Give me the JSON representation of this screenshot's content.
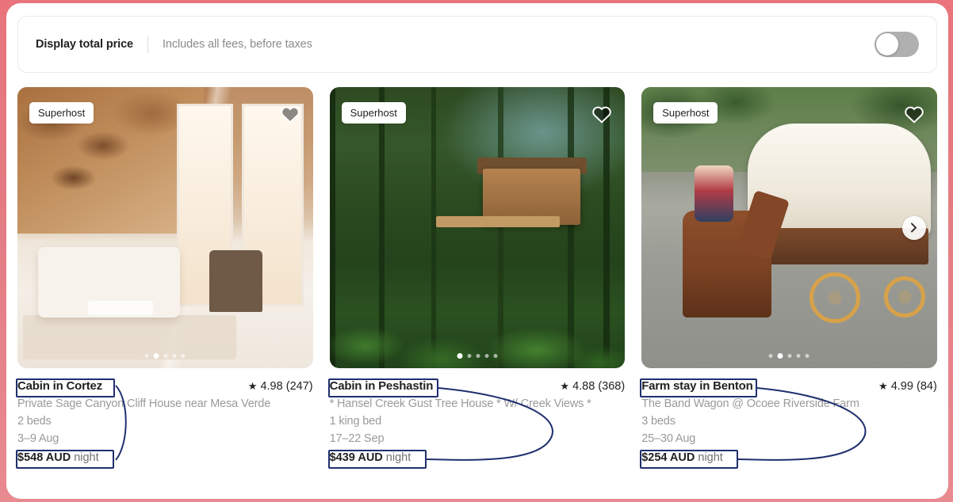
{
  "header": {
    "title": "Display total price",
    "subtitle": "Includes all fees, before taxes",
    "toggle_state": "off",
    "toggle_name": "display-total-price-toggle"
  },
  "colors": {
    "page_background": "#e4747c",
    "panel": "#ffffff",
    "text_primary": "#222222",
    "text_muted": "#9a9a9a",
    "annotation": "#1f2f6e",
    "toggle_off": "#b0b0b0"
  },
  "listings": [
    {
      "badge": "Superhost",
      "title": "Cabin in Cortez",
      "subtitle": "Private Sage Canyon Cliff House near Mesa Verde",
      "beds": "2 beds",
      "dates": "3–9 Aug",
      "price_amount": "$548 AUD",
      "price_unit": "night",
      "rating": "4.98",
      "reviews": "(247)",
      "star": "★",
      "dots_total": 5,
      "dots_active": 1,
      "has_next_arrow": false
    },
    {
      "badge": "Superhost",
      "title": "Cabin in Peshastin",
      "subtitle": "* Hansel Creek Gust Tree House * W/ Creek Views *",
      "beds": "1 king bed",
      "dates": "17–22 Sep",
      "price_amount": "$439 AUD",
      "price_unit": "night",
      "rating": "4.88",
      "reviews": "(368)",
      "star": "★",
      "dots_total": 5,
      "dots_active": 1,
      "has_next_arrow": false
    },
    {
      "badge": "Superhost",
      "title": "Farm stay in Benton",
      "subtitle": "The Band Wagon @ Ocoee Riverside Farm",
      "beds": "3 beds",
      "dates": "25–30 Aug",
      "price_amount": "$254 AUD",
      "price_unit": "night",
      "rating": "4.99",
      "reviews": "(84)",
      "star": "★",
      "dots_total": 5,
      "dots_active": 1,
      "has_next_arrow": true
    }
  ],
  "annotation": {
    "description": "Navy boxes highlight each listing title and each nightly price, joined by a curved connector line.",
    "color": "#1f2f6e",
    "stroke_width": 2
  }
}
